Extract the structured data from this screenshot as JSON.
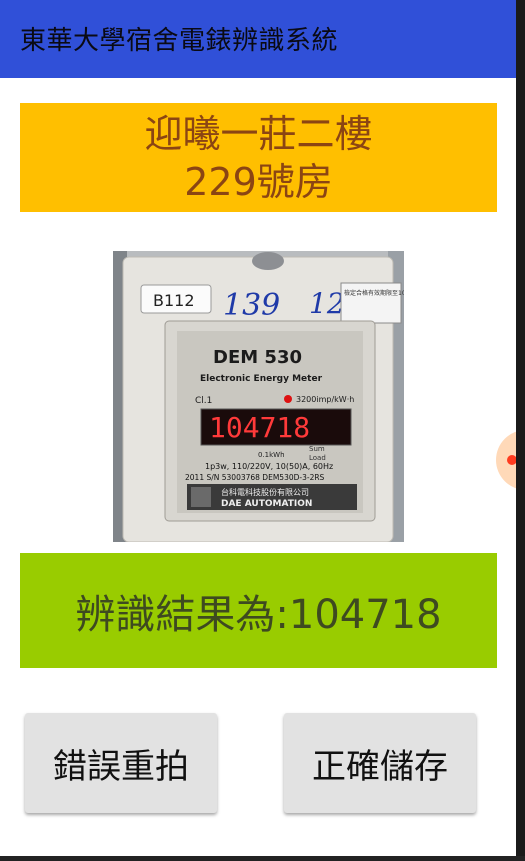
{
  "app": {
    "title": "東華大學宿舍電錶辨識系統"
  },
  "room": {
    "line1": "迎曦一莊二樓",
    "line2": "229號房"
  },
  "meter_photo": {
    "sticker_code": "B112",
    "handwritten_left": "139",
    "handwritten_right": "12",
    "brand": "DEM 530",
    "subtitle": "Electronic Energy Meter",
    "class": "Cl.1",
    "imp_rate": "3200imp/kW·h",
    "display_reading": "104718",
    "unit": "0.1kWh",
    "spec": "1p3w, 110/220V, 10(50)A, 60Hz",
    "serial": "2011 S/N 53003768  DEM530D-3-2RS",
    "maker_cn": "台科電科技股份有限公司",
    "maker_en": "DAE AUTOMATION",
    "inspection_cn": "檢定合格有效期限至108年3月",
    "accent_red": "#ff2a2a"
  },
  "result": {
    "text": "辨識結果為:104718"
  },
  "buttons": {
    "retake": "錯誤重拍",
    "save": "正確儲存"
  },
  "colors": {
    "appbar": "#3050d8",
    "room_banner": "#ffbf00",
    "room_text": "#8b4513",
    "result_bg": "#99cc00",
    "result_text": "#3e4a20",
    "button_bg": "#e2e2e2"
  }
}
